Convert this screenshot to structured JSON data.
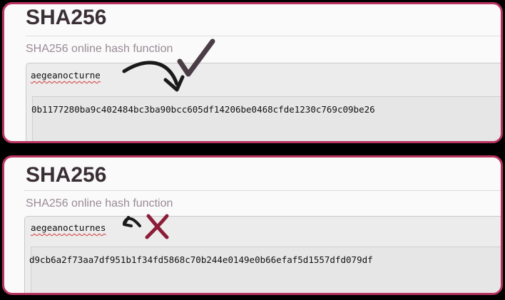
{
  "examples": [
    {
      "title": "SHA256",
      "subtitle": "SHA256 online hash function",
      "input": "aegeanocturne",
      "hash": "0b1177280ba9c402484bc3ba90bcc605df14206be0468cfde1230c769c09be26",
      "mark": "check-mark"
    },
    {
      "title": "SHA256",
      "subtitle": "SHA256 online hash function",
      "input": "aegeanocturnes",
      "hash": "d9cb6a2f73aa7df951b1f34fd5868c70b244e0149e0b66efaf5d1557dfd079df",
      "mark": "x-mark"
    }
  ],
  "colors": {
    "panel_border": "#b8345e",
    "arrow": "#1a1a1a",
    "x_mark": "#8c1c38",
    "check_mark": "#4a3d45"
  }
}
